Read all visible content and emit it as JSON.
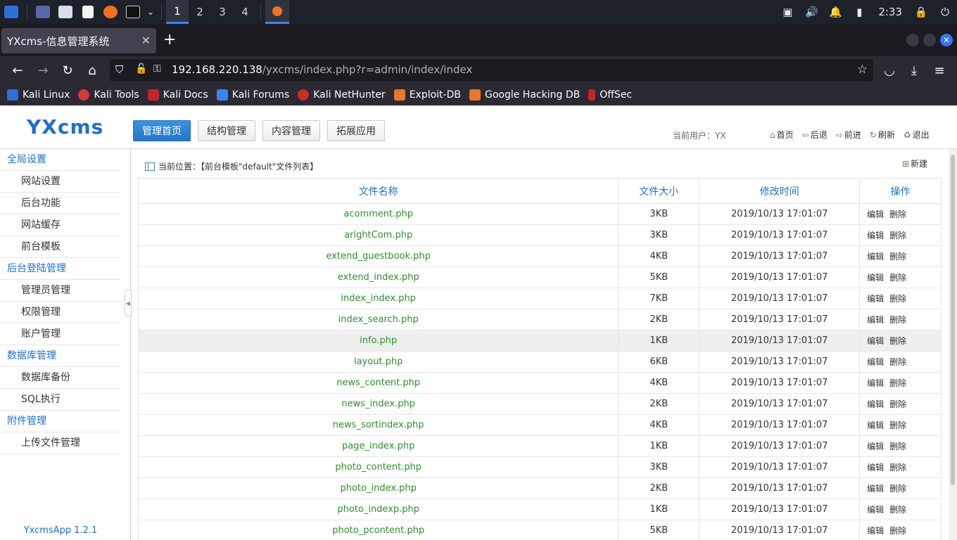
{
  "taskbar": {
    "workspaces": [
      "1",
      "2",
      "3",
      "4"
    ],
    "clock": "2:33",
    "colors": {
      "bg": "#1d2129",
      "active": "#3b82f6"
    }
  },
  "browser": {
    "tab_title": "YXcms-信息管理系统",
    "url_host": "192.168.220.138",
    "url_path": "/yxcms/index.php?r=admin/index/index",
    "bookmarks": [
      "Kali Linux",
      "Kali Tools",
      "Kali Docs",
      "Kali Forums",
      "Kali NetHunter",
      "Exploit-DB",
      "Google Hacking DB",
      "OffSec"
    ]
  },
  "header": {
    "logo": "YXcms",
    "nav": [
      "管理首页",
      "结构管理",
      "内容管理",
      "拓展应用"
    ],
    "current_user": "当前用户：YX",
    "links": [
      "首页",
      "后退",
      "前进",
      "刷新",
      "退出"
    ]
  },
  "sidebar": {
    "groups": [
      {
        "title": "全局设置",
        "items": [
          "网站设置",
          "后台功能",
          "网站缓存",
          "前台模板"
        ]
      },
      {
        "title": "后台登陆管理",
        "items": [
          "管理员管理",
          "权限管理",
          "账户管理"
        ]
      },
      {
        "title": "数据库管理",
        "items": [
          "数据库备份",
          "SQL执行"
        ]
      },
      {
        "title": "附件管理",
        "items": [
          "上传文件管理"
        ]
      }
    ],
    "version": "YxcmsApp 1.2.1"
  },
  "main": {
    "breadcrumb": "当前位置：【前台模板\"default\"文件列表】",
    "new_label": "新建",
    "columns": [
      "文件名称",
      "文件大小",
      "修改时间",
      "操作"
    ],
    "edit_label": "编辑",
    "delete_label": "删除",
    "rows": [
      {
        "name": "acomment.php",
        "size": "3KB",
        "time": "2019/10/13 17:01:07"
      },
      {
        "name": "arightCom.php",
        "size": "3KB",
        "time": "2019/10/13 17:01:07"
      },
      {
        "name": "extend_guestbook.php",
        "size": "4KB",
        "time": "2019/10/13 17:01:07"
      },
      {
        "name": "extend_index.php",
        "size": "5KB",
        "time": "2019/10/13 17:01:07"
      },
      {
        "name": "index_index.php",
        "size": "7KB",
        "time": "2019/10/13 17:01:07"
      },
      {
        "name": "index_search.php",
        "size": "2KB",
        "time": "2019/10/13 17:01:07"
      },
      {
        "name": "info.php",
        "size": "1KB",
        "time": "2019/10/13 17:01:07"
      },
      {
        "name": "layout.php",
        "size": "6KB",
        "time": "2019/10/13 17:01:07"
      },
      {
        "name": "news_content.php",
        "size": "4KB",
        "time": "2019/10/13 17:01:07"
      },
      {
        "name": "news_index.php",
        "size": "2KB",
        "time": "2019/10/13 17:01:07"
      },
      {
        "name": "news_sortindex.php",
        "size": "4KB",
        "time": "2019/10/13 17:01:07"
      },
      {
        "name": "page_index.php",
        "size": "1KB",
        "time": "2019/10/13 17:01:07"
      },
      {
        "name": "photo_content.php",
        "size": "3KB",
        "time": "2019/10/13 17:01:07"
      },
      {
        "name": "photo_index.php",
        "size": "2KB",
        "time": "2019/10/13 17:01:07"
      },
      {
        "name": "photo_indexp.php",
        "size": "1KB",
        "time": "2019/10/13 17:01:07"
      },
      {
        "name": "photo_pcontent.php",
        "size": "5KB",
        "time": "2019/10/13 17:01:07"
      }
    ],
    "highlight_row": 6
  },
  "colors": {
    "accent": "#1f6fce",
    "filename": "#2d8f2d",
    "nav_active": "#2277c8"
  }
}
